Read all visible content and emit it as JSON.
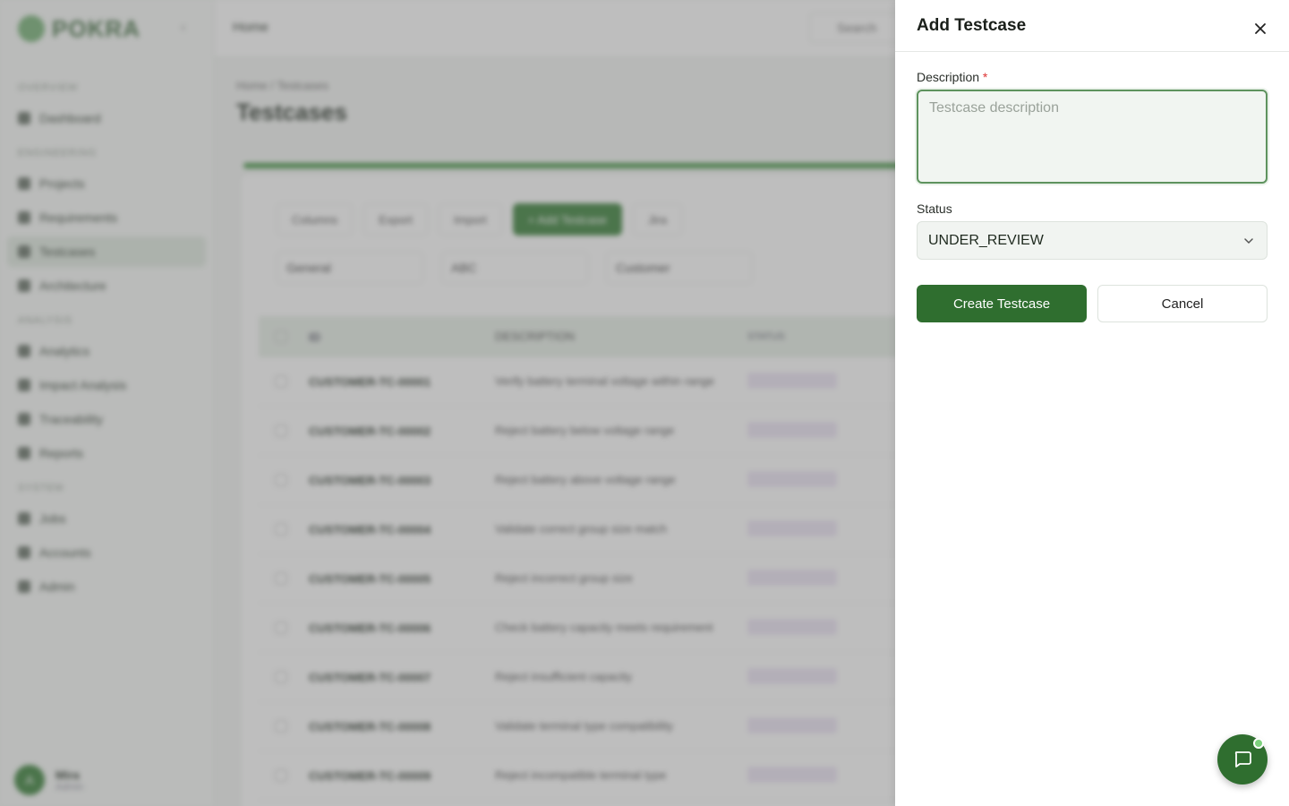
{
  "background": {
    "brand": "POKRA",
    "sidebar": {
      "sections": [
        {
          "label": "OVERVIEW",
          "items": [
            {
              "label": "Dashboard",
              "active": false
            }
          ]
        },
        {
          "label": "ENGINEERING",
          "items": [
            {
              "label": "Projects",
              "active": false
            },
            {
              "label": "Requirements",
              "active": false
            },
            {
              "label": "Testcases",
              "active": true
            },
            {
              "label": "Architecture",
              "active": false
            }
          ]
        },
        {
          "label": "ANALYSIS",
          "items": [
            {
              "label": "Analytics",
              "active": false
            },
            {
              "label": "Impact Analysis",
              "active": false
            },
            {
              "label": "Traceability",
              "active": false
            },
            {
              "label": "Reports",
              "active": false
            }
          ]
        },
        {
          "label": "SYSTEM",
          "items": [
            {
              "label": "Jobs",
              "active": false
            },
            {
              "label": "Accounts",
              "active": false
            },
            {
              "label": "Admin",
              "active": false
            }
          ]
        }
      ],
      "user": {
        "initial": "A",
        "name": "Mira",
        "role": "Admin"
      }
    },
    "topbar": {
      "title": "Home",
      "search_placeholder": "Search"
    },
    "breadcrumb": "Home / Testcases",
    "page_title": "Testcases",
    "toolbar": [
      "Columns",
      "Export",
      "Import",
      "+ Add Testcase",
      "Jira"
    ],
    "filters": [
      "General",
      "ABC",
      "Customer"
    ],
    "table": {
      "columns": [
        "ID",
        "DESCRIPTION",
        "STATUS"
      ],
      "rows": [
        {
          "id": "CUSTOMER-TC-00001",
          "desc": "Verify battery terminal voltage within range"
        },
        {
          "id": "CUSTOMER-TC-00002",
          "desc": "Reject battery below voltage range"
        },
        {
          "id": "CUSTOMER-TC-00003",
          "desc": "Reject battery above voltage range"
        },
        {
          "id": "CUSTOMER-TC-00004",
          "desc": "Validate correct group size match"
        },
        {
          "id": "CUSTOMER-TC-00005",
          "desc": "Reject incorrect group size"
        },
        {
          "id": "CUSTOMER-TC-00006",
          "desc": "Check battery capacity meets requirement"
        },
        {
          "id": "CUSTOMER-TC-00007",
          "desc": "Reject insufficient capacity"
        },
        {
          "id": "CUSTOMER-TC-00008",
          "desc": "Validate terminal type compatibility"
        },
        {
          "id": "CUSTOMER-TC-00009",
          "desc": "Reject incompatible terminal type"
        }
      ]
    }
  },
  "drawer": {
    "title": "Add Testcase",
    "description_label": "Description",
    "required_mark": "*",
    "description_placeholder": "Testcase description",
    "description_value": "",
    "status_label": "Status",
    "status_value": "UNDER_REVIEW",
    "create_label": "Create Testcase",
    "cancel_label": "Cancel"
  },
  "icons": {
    "close": "close-icon",
    "chevron": "chevron-down-icon",
    "chat": "chat-bubble-icon"
  },
  "colors": {
    "primary": "#2f6e2f",
    "focus_border": "#5e935e",
    "required": "#dd3333"
  }
}
